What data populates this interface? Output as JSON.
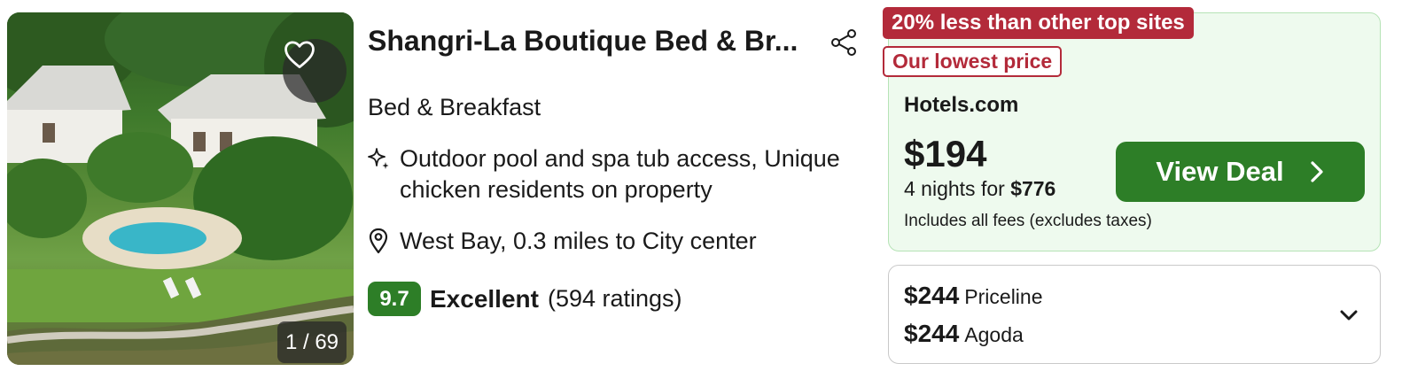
{
  "hotel": {
    "title": "Shangri-La Boutique Bed & Br...",
    "type": "Bed & Breakfast",
    "amenities": "Outdoor pool and spa tub access, Unique chicken residents on property",
    "location": "West Bay, 0.3 miles to City center",
    "rating": {
      "score": "9.7",
      "label": "Excellent",
      "count": "(594 ratings)"
    },
    "photo_counter": "1 / 69"
  },
  "deal": {
    "badge_savings": "20% less than other top sites",
    "badge_lowest": "Our lowest price",
    "provider": "Hotels.com",
    "price": "$194",
    "nights_prefix": "4 nights for ",
    "nights_total": "$776",
    "fees_note": "Includes all fees (excludes taxes)",
    "cta_label": "View Deal"
  },
  "other_prices": [
    {
      "amount": "$244",
      "provider": "Priceline"
    },
    {
      "amount": "$244",
      "provider": "Agoda"
    }
  ],
  "icons": {
    "favorite": "heart-icon",
    "share": "share-icon",
    "amenity": "sparkle-icon",
    "location": "map-pin-icon",
    "cta": "chevron-right-icon",
    "expand": "chevron-down-icon"
  },
  "colors": {
    "rating_green": "#2d7e27",
    "cta_green": "#2d7e27",
    "badge_red": "#b32a3a",
    "deal_bg": "#eefaee",
    "deal_border": "#b6e3b6"
  }
}
